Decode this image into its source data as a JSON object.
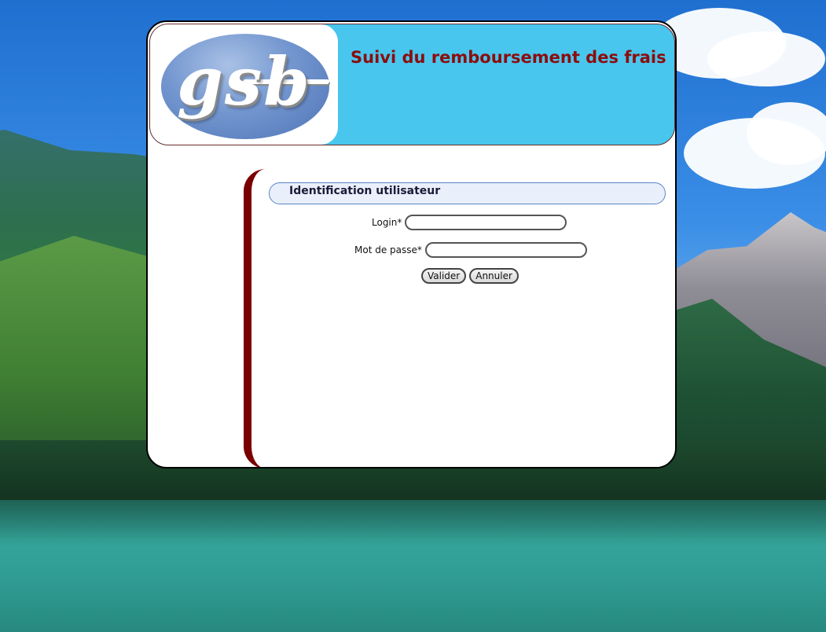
{
  "header": {
    "logo_text": "gsb",
    "title": "Suivi du remboursement des frais"
  },
  "login_form": {
    "legend": "Identification utilisateur",
    "login_label": "Login*",
    "login_value": "",
    "password_label": "Mot de passe*",
    "password_value": "",
    "submit_label": "Valider",
    "reset_label": "Annuler"
  },
  "colors": {
    "header_bg": "#48c6ee",
    "title_color": "#8b0d0d",
    "content_border": "#7a0000",
    "legend_bg": "#e9f0fb"
  }
}
